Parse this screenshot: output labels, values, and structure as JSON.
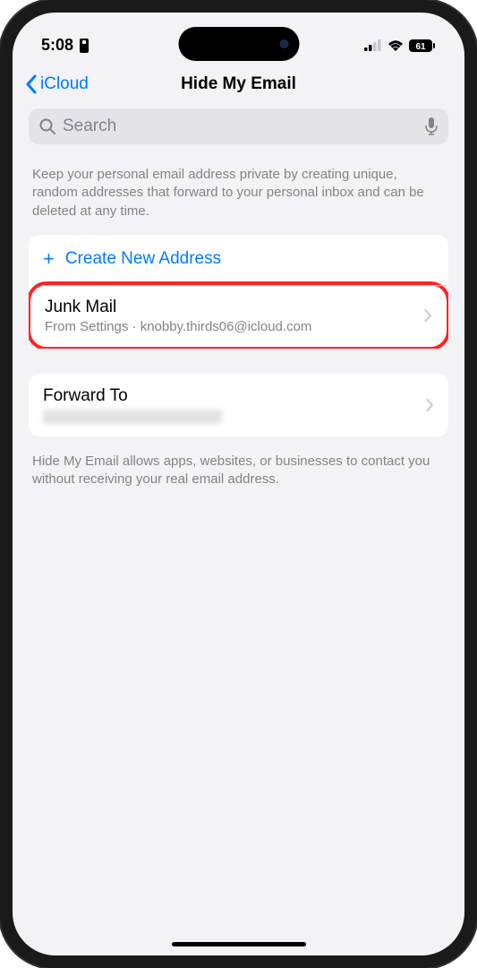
{
  "status": {
    "time": "5:08",
    "battery": "61"
  },
  "nav": {
    "back": "iCloud",
    "title": "Hide My Email"
  },
  "search": {
    "placeholder": "Search"
  },
  "description": "Keep your personal email address private by creating unique, random addresses that forward to your personal inbox and can be deleted at any time.",
  "create": {
    "label": "Create New Address"
  },
  "junk": {
    "title": "Junk Mail",
    "subtitle": "From Settings · knobby.thirds06@icloud.com"
  },
  "forward": {
    "title": "Forward To"
  },
  "footer": "Hide My Email allows apps, websites, or businesses to contact you without receiving your real email address."
}
